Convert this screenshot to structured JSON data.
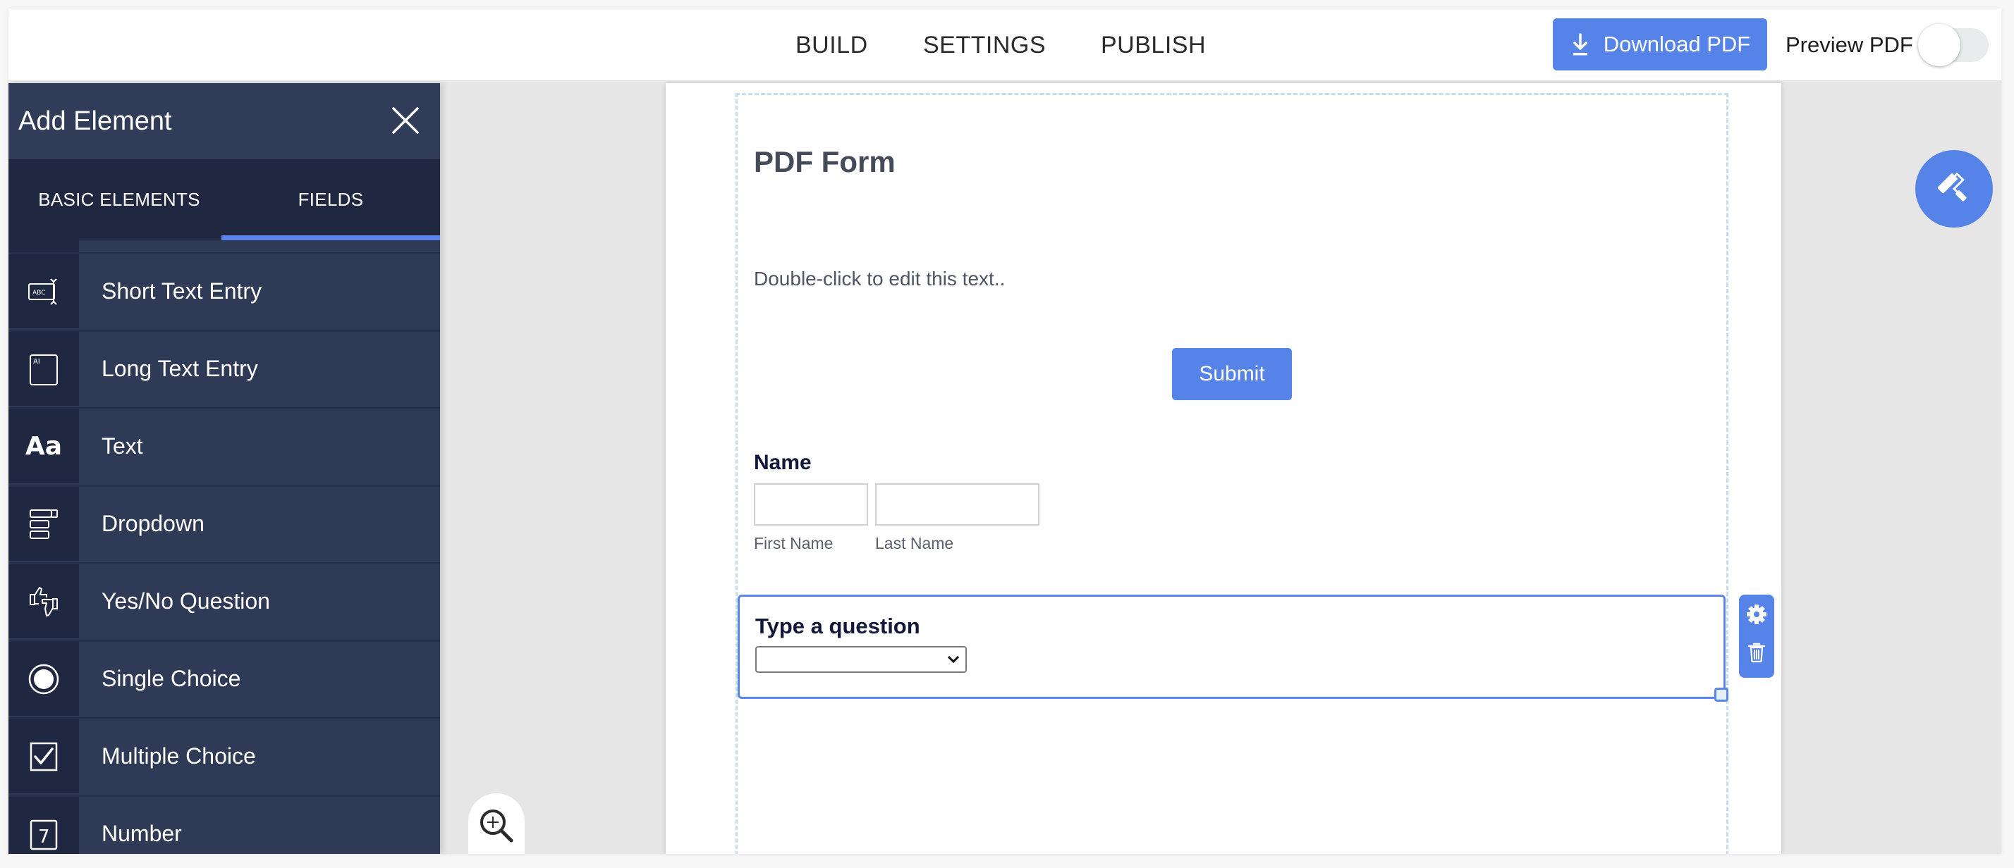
{
  "topbar": {
    "nav": [
      {
        "label": "BUILD"
      },
      {
        "label": "SETTINGS"
      },
      {
        "label": "PUBLISH"
      }
    ],
    "download_button": {
      "label": "Download PDF",
      "icon": "download-icon"
    },
    "preview_toggle": {
      "label": "Preview PDF",
      "state": "off"
    }
  },
  "sidebar": {
    "title": "Add Element",
    "close_icon": "close-icon",
    "tabs": [
      {
        "label": "BASIC ELEMENTS",
        "active": false
      },
      {
        "label": "FIELDS",
        "active": true
      }
    ],
    "items": [
      {
        "label": "Short Text Entry",
        "icon": "short-text-icon"
      },
      {
        "label": "Long Text Entry",
        "icon": "long-text-icon"
      },
      {
        "label": "Text",
        "icon": "text-icon",
        "glyph": "Aa"
      },
      {
        "label": "Dropdown",
        "icon": "dropdown-icon"
      },
      {
        "label": "Yes/No Question",
        "icon": "thumbs-up-down-icon"
      },
      {
        "label": "Single Choice",
        "icon": "radio-icon"
      },
      {
        "label": "Multiple Choice",
        "icon": "checkbox-icon"
      },
      {
        "label": "Number",
        "icon": "number-icon",
        "glyph": "7"
      }
    ]
  },
  "form": {
    "title": "PDF Form",
    "text": "Double-click to edit this text..",
    "submit_label": "Submit",
    "name_field": {
      "label": "Name",
      "first": {
        "value": "",
        "sublabel": "First Name"
      },
      "last": {
        "value": "",
        "sublabel": "Last Name"
      }
    },
    "question": {
      "label": "Type a question",
      "selected": ""
    }
  },
  "colors": {
    "accent": "#5683e8",
    "sidebar_bg": "#2f3a56",
    "sidebar_dark": "#1f2741",
    "canvas_bg": "#e6e6e6"
  }
}
